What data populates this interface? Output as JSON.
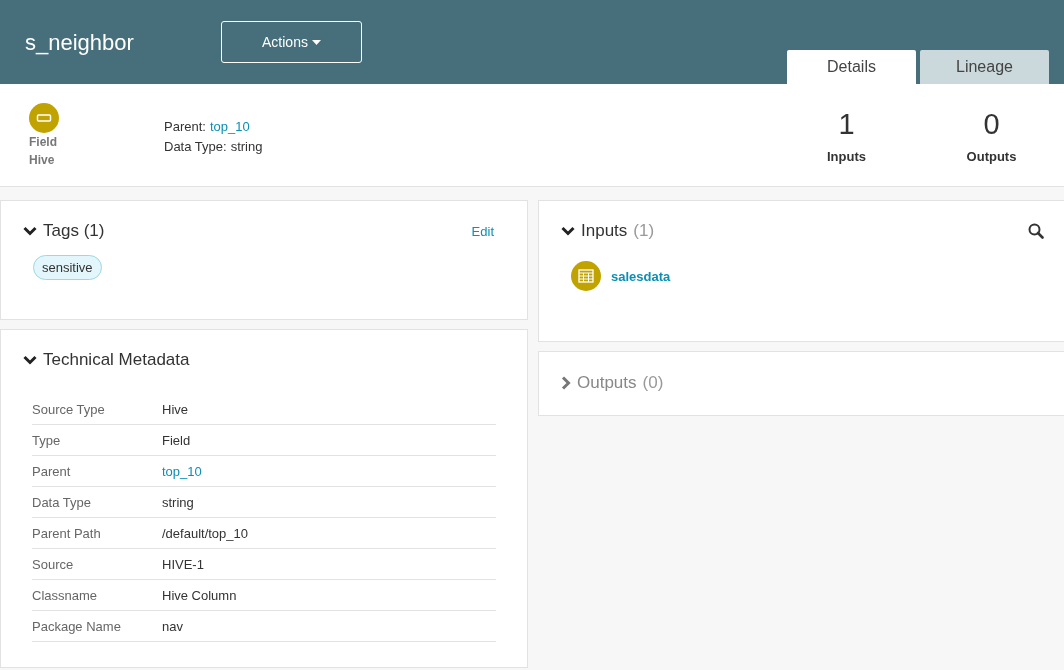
{
  "header": {
    "title": "s_neighbor",
    "actions_button": "Actions"
  },
  "tabs": [
    {
      "label": "Details",
      "selected": true
    },
    {
      "label": "Lineage",
      "selected": false
    }
  ],
  "summary": {
    "type": "Field",
    "source": "Hive",
    "fields": [
      {
        "label": "Parent:",
        "value": "top_10",
        "kind": "link"
      },
      {
        "label": "Data Type:",
        "value": "string",
        "kind": "text"
      }
    ],
    "stats": [
      {
        "value": "1",
        "label": "Inputs"
      },
      {
        "value": "0",
        "label": "Outputs"
      }
    ]
  },
  "tags": {
    "title": "Tags (1)",
    "expanded": true,
    "edit": "Edit",
    "items": [
      "sensitive"
    ]
  },
  "metadata": {
    "title": "Technical Metadata",
    "expanded": true,
    "rows": [
      {
        "label": "Source Type",
        "value": "Hive",
        "kind": "text"
      },
      {
        "label": "Type",
        "value": "Field",
        "kind": "text"
      },
      {
        "label": "Parent",
        "value": "top_10",
        "kind": "link"
      },
      {
        "label": "Data Type",
        "value": "string",
        "kind": "text"
      },
      {
        "label": "Parent Path",
        "value": "/default/top_10",
        "kind": "text"
      },
      {
        "label": "Source",
        "value": "HIVE-1",
        "kind": "text"
      },
      {
        "label": "Classname",
        "value": "Hive Column",
        "kind": "text"
      },
      {
        "label": "Package Name",
        "value": "nav",
        "kind": "text"
      }
    ]
  },
  "inputs": {
    "title": "Inputs",
    "count": "(1)",
    "expanded": true,
    "items": [
      {
        "name": "salesdata"
      }
    ]
  },
  "outputs": {
    "title": "Outputs",
    "count": "(0)",
    "expanded": false
  }
}
